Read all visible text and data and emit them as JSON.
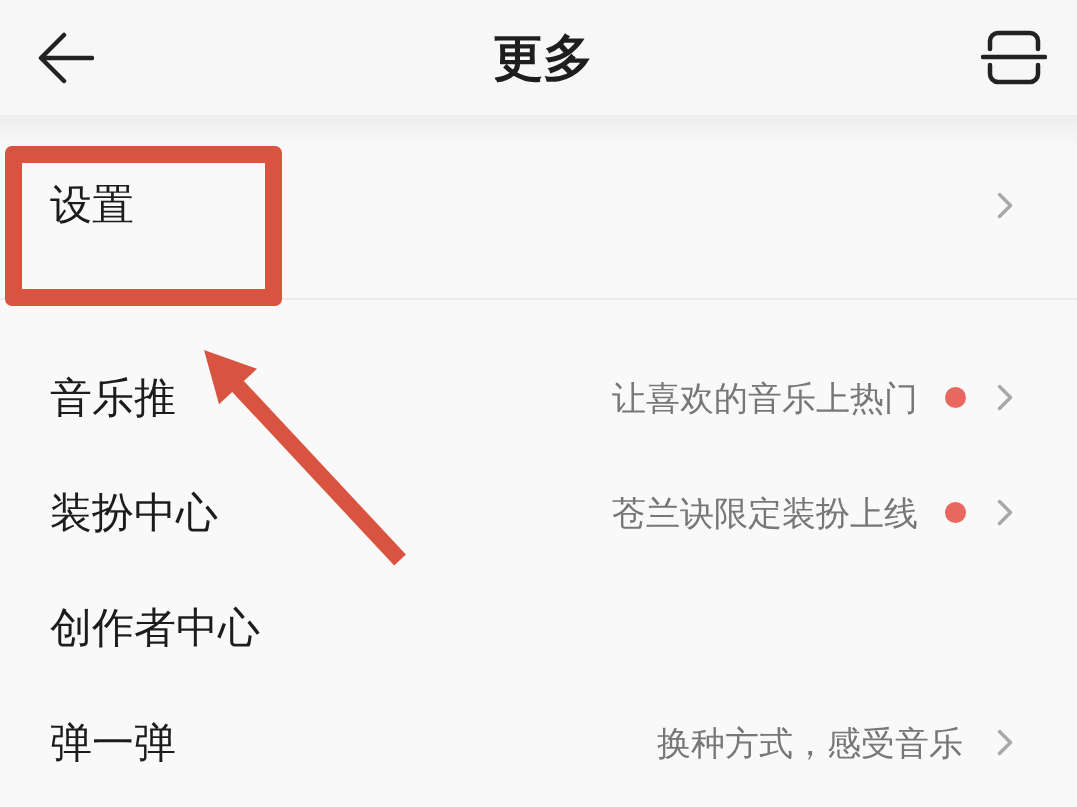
{
  "top_bar": {
    "title": "更多"
  },
  "groups": [
    {
      "items": [
        {
          "label": "设置",
          "dot": false,
          "chevron": true,
          "highlighted": true
        }
      ]
    },
    {
      "items": [
        {
          "label": "音乐推",
          "subtitle": "让喜欢的音乐上热门",
          "dot": true,
          "chevron": true,
          "highlighted": false
        },
        {
          "label": "装扮中心",
          "subtitle": "苍兰诀限定装扮上线",
          "dot": true,
          "chevron": true,
          "highlighted": false
        },
        {
          "label": "创作者中心",
          "dot": false,
          "chevron": false,
          "highlighted": false
        },
        {
          "label": "弹一弹",
          "subtitle": "换种方式，感受音乐",
          "dot": false,
          "chevron": true,
          "highlighted": false
        }
      ]
    }
  ]
}
